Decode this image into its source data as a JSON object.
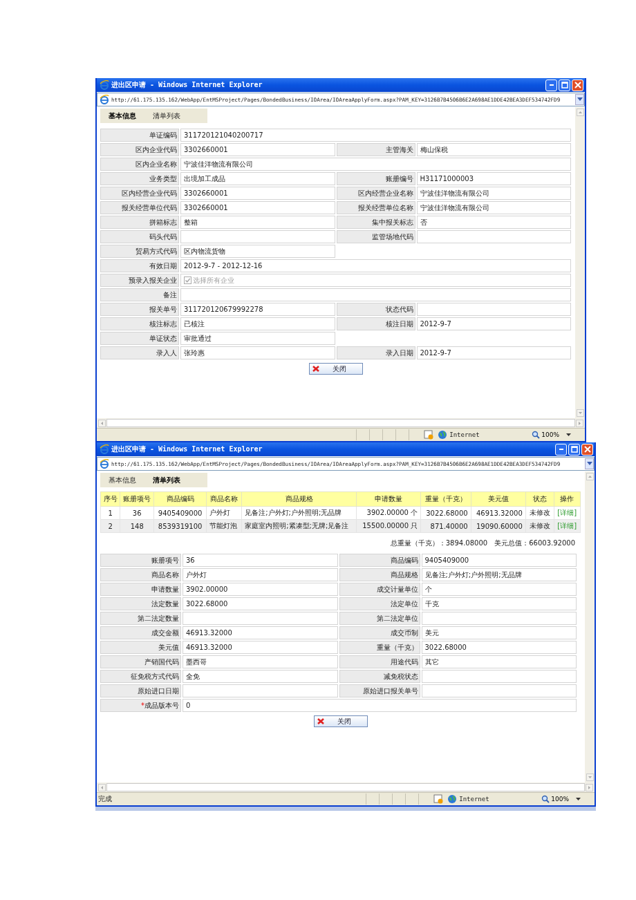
{
  "windows": [
    {
      "title": "进出区申请 - Windows Internet Explorer",
      "url": "http://61.175.135.162/WebApp/EntMSProject/Pages/BondedBusiness/IOArea/IOAreaApplyForm.aspx?PAM_KEY=3126B7B4506B6E2A698AE1DDE42BEA3DEF534742FD9",
      "tabs": [
        {
          "label": "基本信息",
          "selected": true
        },
        {
          "label": "清单列表",
          "selected": false
        }
      ],
      "form": [
        {
          "kind": "wide",
          "fields": [
            {
              "label": "单证编码",
              "value": "311720121040200717"
            }
          ]
        },
        {
          "kind": "pair",
          "fields": [
            {
              "label": "区内企业代码",
              "value": "3302660001"
            },
            {
              "label": "主管海关",
              "value": "梅山保税"
            }
          ]
        },
        {
          "kind": "wide",
          "fields": [
            {
              "label": "区内企业名称",
              "value": "宁波佳洋物流有限公司"
            }
          ]
        },
        {
          "kind": "pair",
          "fields": [
            {
              "label": "业务类型",
              "value": "出境加工成品"
            },
            {
              "label": "账册编号",
              "value": "H31171000003"
            }
          ]
        },
        {
          "kind": "pair",
          "fields": [
            {
              "label": "区内经营企业代码",
              "value": "3302660001"
            },
            {
              "label": "区内经营企业名称",
              "value": "宁波佳洋物流有限公司"
            }
          ]
        },
        {
          "kind": "pair",
          "fields": [
            {
              "label": "报关经营单位代码",
              "value": "3302660001"
            },
            {
              "label": "报关经营单位名称",
              "value": "宁波佳洋物流有限公司"
            }
          ]
        },
        {
          "kind": "pair",
          "fields": [
            {
              "label": "拼箱标志",
              "value": "整箱"
            },
            {
              "label": "集中报关标志",
              "value": "否"
            }
          ]
        },
        {
          "kind": "pair",
          "fields": [
            {
              "label": "码头代码"
            },
            {
              "label": "监管场地代码"
            }
          ]
        },
        {
          "kind": "half",
          "fields": [
            {
              "label": "贸易方式代码",
              "value": "区内物流货物"
            }
          ]
        },
        {
          "kind": "wide",
          "fields": [
            {
              "label": "有效日期",
              "value": "2012-9-7 -  2012-12-16"
            }
          ]
        },
        {
          "kind": "checkbox",
          "fields": [
            {
              "label": "预录入报关企业",
              "option": "选择所有企业",
              "checked": true,
              "disabled": true
            }
          ]
        },
        {
          "kind": "wide",
          "fields": [
            {
              "label": "备注"
            }
          ]
        },
        {
          "kind": "pair",
          "fields": [
            {
              "label": "报关单号",
              "value": "311720120679992278"
            },
            {
              "label": "状态代码"
            }
          ]
        },
        {
          "kind": "pair",
          "fields": [
            {
              "label": "核注标志",
              "value": "已核注"
            },
            {
              "label": "核注日期",
              "value": "2012-9-7"
            }
          ]
        },
        {
          "kind": "half",
          "fields": [
            {
              "label": "单证状态",
              "value": "审批通过"
            }
          ]
        },
        {
          "kind": "pair",
          "fields": [
            {
              "label": "录入人",
              "value": "张玲惠"
            },
            {
              "label": "录入日期",
              "value": "2012-9-7"
            }
          ]
        }
      ],
      "close_button": "关闭",
      "status_bar": {
        "zone": "Internet",
        "zoom": "100%"
      }
    },
    {
      "title": "进出区申请 - Windows Internet Explorer",
      "url": "http://61.175.135.162/WebApp/EntMSProject/Pages/BondedBusiness/IOArea/IOAreaApplyForm.aspx?PAM_KEY=3126B7B4506B6E2A698AE1DDE42BEA3DEF534742FD9",
      "tabs": [
        {
          "label": "基本信息",
          "selected": false
        },
        {
          "label": "清单列表",
          "selected": true
        }
      ],
      "table": {
        "columns": [
          "序号",
          "账册项号",
          "商品编码",
          "商品名称",
          "商品规格",
          "申请数量",
          "重量（千克）",
          "美元值",
          "状态",
          "操作"
        ],
        "rows": [
          {
            "cells": [
              "1",
              "36",
              "9405409000",
              "户外灯",
              "见备注;户外灯;户外照明;无品牌",
              "3902.00000 个",
              "3022.68000",
              "46913.32000",
              "未修改",
              "[详细]"
            ],
            "selected": false
          },
          {
            "cells": [
              "2",
              "148",
              "8539319100",
              "节能灯泡",
              "家庭室内照明;紧凑型;无牌;见备注",
              "15500.00000 只",
              "871.40000",
              "19090.60000",
              "未修改",
              "[详细]"
            ],
            "selected": true
          }
        ]
      },
      "totals": [
        "总重量（千克）：3894.08000",
        "美元总值：66003.92000"
      ],
      "form": [
        {
          "kind": "pair",
          "fields": [
            {
              "label": "账册项号",
              "value": "36"
            },
            {
              "label": "商品编码",
              "value": "9405409000"
            }
          ]
        },
        {
          "kind": "pair",
          "fields": [
            {
              "label": "商品名称",
              "value": "户外灯"
            },
            {
              "label": "商品规格",
              "value": "见备注;户外灯;户外照明;无品牌"
            }
          ]
        },
        {
          "kind": "pair",
          "fields": [
            {
              "label": "申请数量",
              "value": "3902.00000"
            },
            {
              "label": "成交计量单位",
              "value": "个"
            }
          ]
        },
        {
          "kind": "pair",
          "fields": [
            {
              "label": "法定数量",
              "value": "3022.68000"
            },
            {
              "label": "法定单位",
              "value": "千克"
            }
          ]
        },
        {
          "kind": "pair",
          "fields": [
            {
              "label": "第二法定数量"
            },
            {
              "label": "第二法定单位"
            }
          ]
        },
        {
          "kind": "pair",
          "fields": [
            {
              "label": "成交金额",
              "value": "46913.32000"
            },
            {
              "label": "成交币制",
              "value": "美元"
            }
          ]
        },
        {
          "kind": "pair",
          "fields": [
            {
              "label": "美元值",
              "value": "46913.32000"
            },
            {
              "label": "重量（千克）",
              "value": "3022.68000"
            }
          ]
        },
        {
          "kind": "pair",
          "fields": [
            {
              "label": "产销国代码",
              "value": "墨西哥"
            },
            {
              "label": "用途代码",
              "value": "其它"
            }
          ]
        },
        {
          "kind": "pair",
          "fields": [
            {
              "label": "征免税方式代码",
              "value": "全免"
            },
            {
              "label": "减免税状态"
            }
          ]
        },
        {
          "kind": "pair",
          "fields": [
            {
              "label": "原始进口日期"
            },
            {
              "label": "原始进口报关单号"
            }
          ]
        },
        {
          "kind": "wide",
          "fields": [
            {
              "label": "成品版本号",
              "value": "0",
              "required_mark": "*"
            }
          ]
        }
      ],
      "close_button": "关闭",
      "status_bar": {
        "text": "完成",
        "zone": "Internet",
        "zoom": "100%"
      }
    }
  ]
}
